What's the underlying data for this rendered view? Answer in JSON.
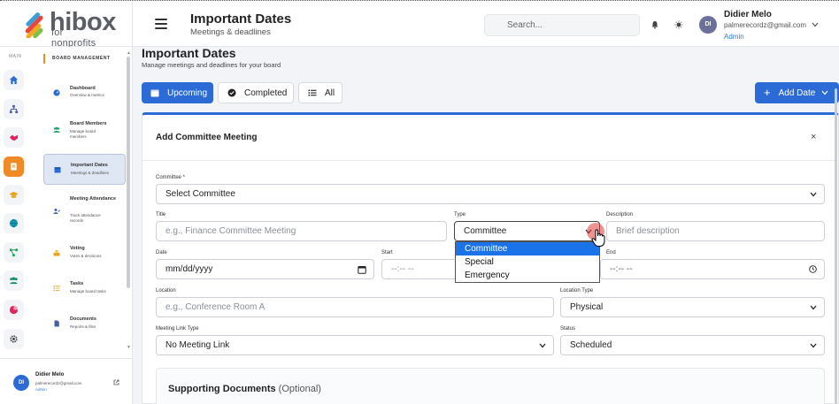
{
  "brand": {
    "name": "hibox",
    "tagline": "for nonprofits"
  },
  "header": {
    "title": "Important Dates",
    "subtitle": "Meetings & deadlines",
    "search_placeholder": "Search..."
  },
  "user": {
    "initials": "DI",
    "name": "Didier Melo",
    "email": "palmerecordz@gmail.com",
    "role": "Admin"
  },
  "rail": {
    "label": "MAIN"
  },
  "nav": {
    "heading": "BOARD MANAGEMENT",
    "items": [
      {
        "title": "Dashboard",
        "desc": [
          "Overview & metrics"
        ],
        "icon": "dashboard-icon"
      },
      {
        "title": "Board Members",
        "desc": [
          "Manage board",
          "members"
        ],
        "icon": "users-icon"
      },
      {
        "title": "Important Dates",
        "desc": [
          "Meetings & deadlines"
        ],
        "icon": "calendar-icon",
        "active": true
      },
      {
        "title": "Meeting Attendance",
        "desc": [
          "Track attendance",
          "records"
        ],
        "icon": "attendance-icon"
      },
      {
        "title": "Voting",
        "desc": [
          "Votes & decisions"
        ],
        "icon": "vote-icon"
      },
      {
        "title": "Tasks",
        "desc": [
          "Manage board tasks"
        ],
        "icon": "tasks-icon"
      },
      {
        "title": "Documents",
        "desc": [
          "Reports & files"
        ],
        "icon": "document-icon"
      }
    ]
  },
  "page": {
    "title": "Important Dates",
    "subtitle": "Manage meetings and deadlines for your board"
  },
  "tabs": {
    "upcoming": "Upcoming",
    "completed": "Completed",
    "all": "All",
    "active": "Upcoming"
  },
  "add_button": "Add Date",
  "form": {
    "title": "Add Committee Meeting",
    "close": "×",
    "committee_label": "Committee *",
    "committee_value": "Select Committee",
    "title_label": "Title",
    "title_placeholder": "e.g., Finance Committee Meeting",
    "type_label": "Type",
    "type_value": "Committee",
    "type_options": [
      "Committee",
      "Special",
      "Emergency"
    ],
    "description_label": "Description",
    "description_placeholder": "Brief description",
    "date_label": "Date",
    "date_placeholder": "mm/dd/yyyy",
    "start_label": "Start",
    "start_placeholder": "--:-- --",
    "end_label": "End",
    "end_placeholder": "--:-- --",
    "location_label": "Location",
    "location_placeholder": "e.g., Conference Room A",
    "location_type_label": "Location Type",
    "location_type_value": "Physical",
    "link_type_label": "Meeting Link Type",
    "link_type_value": "No Meeting Link",
    "status_label": "Status",
    "status_value": "Scheduled",
    "supporting_title": "Supporting Documents",
    "supporting_optional": "(Optional)"
  },
  "colors": {
    "primary": "#2c6bd6",
    "accent": "#f08a24",
    "selected_option": "#1a73e8"
  }
}
